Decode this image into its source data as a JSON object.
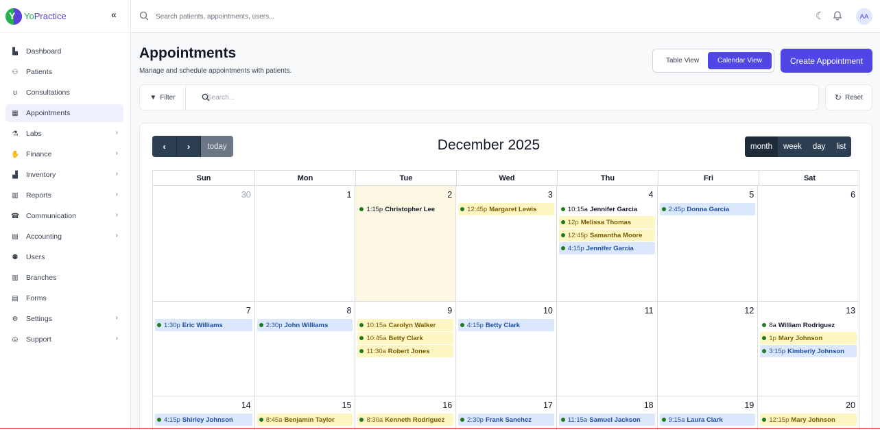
{
  "brand": {
    "name_a": "Yo",
    "name_b": "Practice",
    "logo_letter": "Y"
  },
  "sidebar": {
    "items": [
      {
        "label": "Dashboard",
        "icon": "dashboard-icon",
        "glyph": "▙",
        "chevron": false,
        "active": false
      },
      {
        "label": "Patients",
        "icon": "patients-icon",
        "glyph": "⚇",
        "chevron": false,
        "active": false
      },
      {
        "label": "Consultations",
        "icon": "stethoscope-icon",
        "glyph": "ʊ",
        "chevron": false,
        "active": false
      },
      {
        "label": "Appointments",
        "icon": "calendar-icon",
        "glyph": "▦",
        "chevron": false,
        "active": true
      },
      {
        "label": "Labs",
        "icon": "flask-icon",
        "glyph": "⚗",
        "chevron": true,
        "active": false
      },
      {
        "label": "Finance",
        "icon": "finance-icon",
        "glyph": "✋",
        "chevron": true,
        "active": false
      },
      {
        "label": "Inventory",
        "icon": "inventory-icon",
        "glyph": "▟",
        "chevron": true,
        "active": false
      },
      {
        "label": "Reports",
        "icon": "chart-icon",
        "glyph": "▥",
        "chevron": true,
        "active": false
      },
      {
        "label": "Communication",
        "icon": "communication-icon",
        "glyph": "☎",
        "chevron": true,
        "active": false
      },
      {
        "label": "Accounting",
        "icon": "accounting-icon",
        "glyph": "▤",
        "chevron": true,
        "active": false
      },
      {
        "label": "Users",
        "icon": "users-icon",
        "glyph": "⚉",
        "chevron": false,
        "active": false
      },
      {
        "label": "Branches",
        "icon": "building-icon",
        "glyph": "▥",
        "chevron": false,
        "active": false
      },
      {
        "label": "Forms",
        "icon": "form-icon",
        "glyph": "▤",
        "chevron": false,
        "active": false
      },
      {
        "label": "Settings",
        "icon": "gear-icon",
        "glyph": "⚙",
        "chevron": true,
        "active": false
      },
      {
        "label": "Support",
        "icon": "support-icon",
        "glyph": "◎",
        "chevron": true,
        "active": false
      }
    ]
  },
  "topbar": {
    "search_placeholder": "Search patients, appointments, users...",
    "avatar": "AA"
  },
  "header": {
    "title": "Appointments",
    "subtitle": "Manage and schedule appointments with patients.",
    "table_view": "Table View",
    "calendar_view": "Calendar View",
    "create": "Create Appointment"
  },
  "filterbar": {
    "filter": "Filter",
    "search_placeholder": "Search...",
    "reset": "Reset"
  },
  "calendar": {
    "title": "December 2025",
    "today_label": "today",
    "ranges": [
      "month",
      "week",
      "day",
      "list"
    ],
    "active_range": "month",
    "weekdays": [
      "Sun",
      "Mon",
      "Tue",
      "Wed",
      "Thu",
      "Fri",
      "Sat"
    ],
    "weeks": [
      [
        {
          "day": "30",
          "other": true,
          "events": []
        },
        {
          "day": "1",
          "events": []
        },
        {
          "day": "2",
          "today": true,
          "events": [
            {
              "time": "1:15p",
              "name": "Christopher Lee",
              "style": "plain"
            }
          ]
        },
        {
          "day": "3",
          "events": [
            {
              "time": "12:45p",
              "name": "Margaret Lewis",
              "style": "yellow"
            }
          ]
        },
        {
          "day": "4",
          "events": [
            {
              "time": "10:15a",
              "name": "Jennifer Garcia",
              "style": "plain"
            },
            {
              "time": "12p",
              "name": "Melissa Thomas",
              "style": "yellow"
            },
            {
              "time": "12:45p",
              "name": "Samantha Moore",
              "style": "yellow"
            },
            {
              "time": "4:15p",
              "name": "Jennifer Garcia",
              "style": "blue"
            }
          ]
        },
        {
          "day": "5",
          "events": [
            {
              "time": "2:45p",
              "name": "Donna Garcia",
              "style": "blue"
            }
          ]
        },
        {
          "day": "6",
          "events": []
        }
      ],
      [
        {
          "day": "7",
          "events": [
            {
              "time": "1:30p",
              "name": "Eric Williams",
              "style": "blue"
            }
          ]
        },
        {
          "day": "8",
          "events": [
            {
              "time": "2:30p",
              "name": "John Williams",
              "style": "blue"
            }
          ]
        },
        {
          "day": "9",
          "events": [
            {
              "time": "10:15a",
              "name": "Carolyn Walker",
              "style": "yellow"
            },
            {
              "time": "10:45a",
              "name": "Betty Clark",
              "style": "yellow"
            },
            {
              "time": "11:30a",
              "name": "Robert Jones",
              "style": "yellow"
            }
          ]
        },
        {
          "day": "10",
          "events": [
            {
              "time": "4:15p",
              "name": "Betty Clark",
              "style": "blue"
            }
          ]
        },
        {
          "day": "11",
          "events": []
        },
        {
          "day": "12",
          "events": []
        },
        {
          "day": "13",
          "events": [
            {
              "time": "8a",
              "name": "William Rodriguez",
              "style": "plain"
            },
            {
              "time": "1p",
              "name": "Mary Johnson",
              "style": "yellow"
            },
            {
              "time": "3:15p",
              "name": "Kimberly Johnson",
              "style": "blue"
            }
          ]
        }
      ],
      [
        {
          "day": "14",
          "events": [
            {
              "time": "4:15p",
              "name": "Shirley Johnson",
              "style": "blue"
            }
          ]
        },
        {
          "day": "15",
          "events": [
            {
              "time": "8:45a",
              "name": "Benjamin Taylor",
              "style": "yellow"
            }
          ]
        },
        {
          "day": "16",
          "events": [
            {
              "time": "8:30a",
              "name": "Kenneth Rodriguez",
              "style": "yellow"
            }
          ]
        },
        {
          "day": "17",
          "events": [
            {
              "time": "2:30p",
              "name": "Frank Sanchez",
              "style": "blue"
            }
          ]
        },
        {
          "day": "18",
          "events": [
            {
              "time": "11:15a",
              "name": "Samuel Jackson",
              "style": "blue"
            }
          ]
        },
        {
          "day": "19",
          "events": [
            {
              "time": "9:15a",
              "name": "Laura Clark",
              "style": "blue"
            }
          ]
        },
        {
          "day": "20",
          "events": [
            {
              "time": "12:15p",
              "name": "Mary Johnson",
              "style": "yellow"
            }
          ]
        }
      ]
    ]
  },
  "colors": {
    "accent": "#4f46e5",
    "today_bg": "#fcf8e3",
    "event_yellow": "#fdf6c3",
    "event_blue": "#dbe7fb",
    "dot": "#1f7a1f",
    "toolbar_dark": "#2c3e50"
  }
}
